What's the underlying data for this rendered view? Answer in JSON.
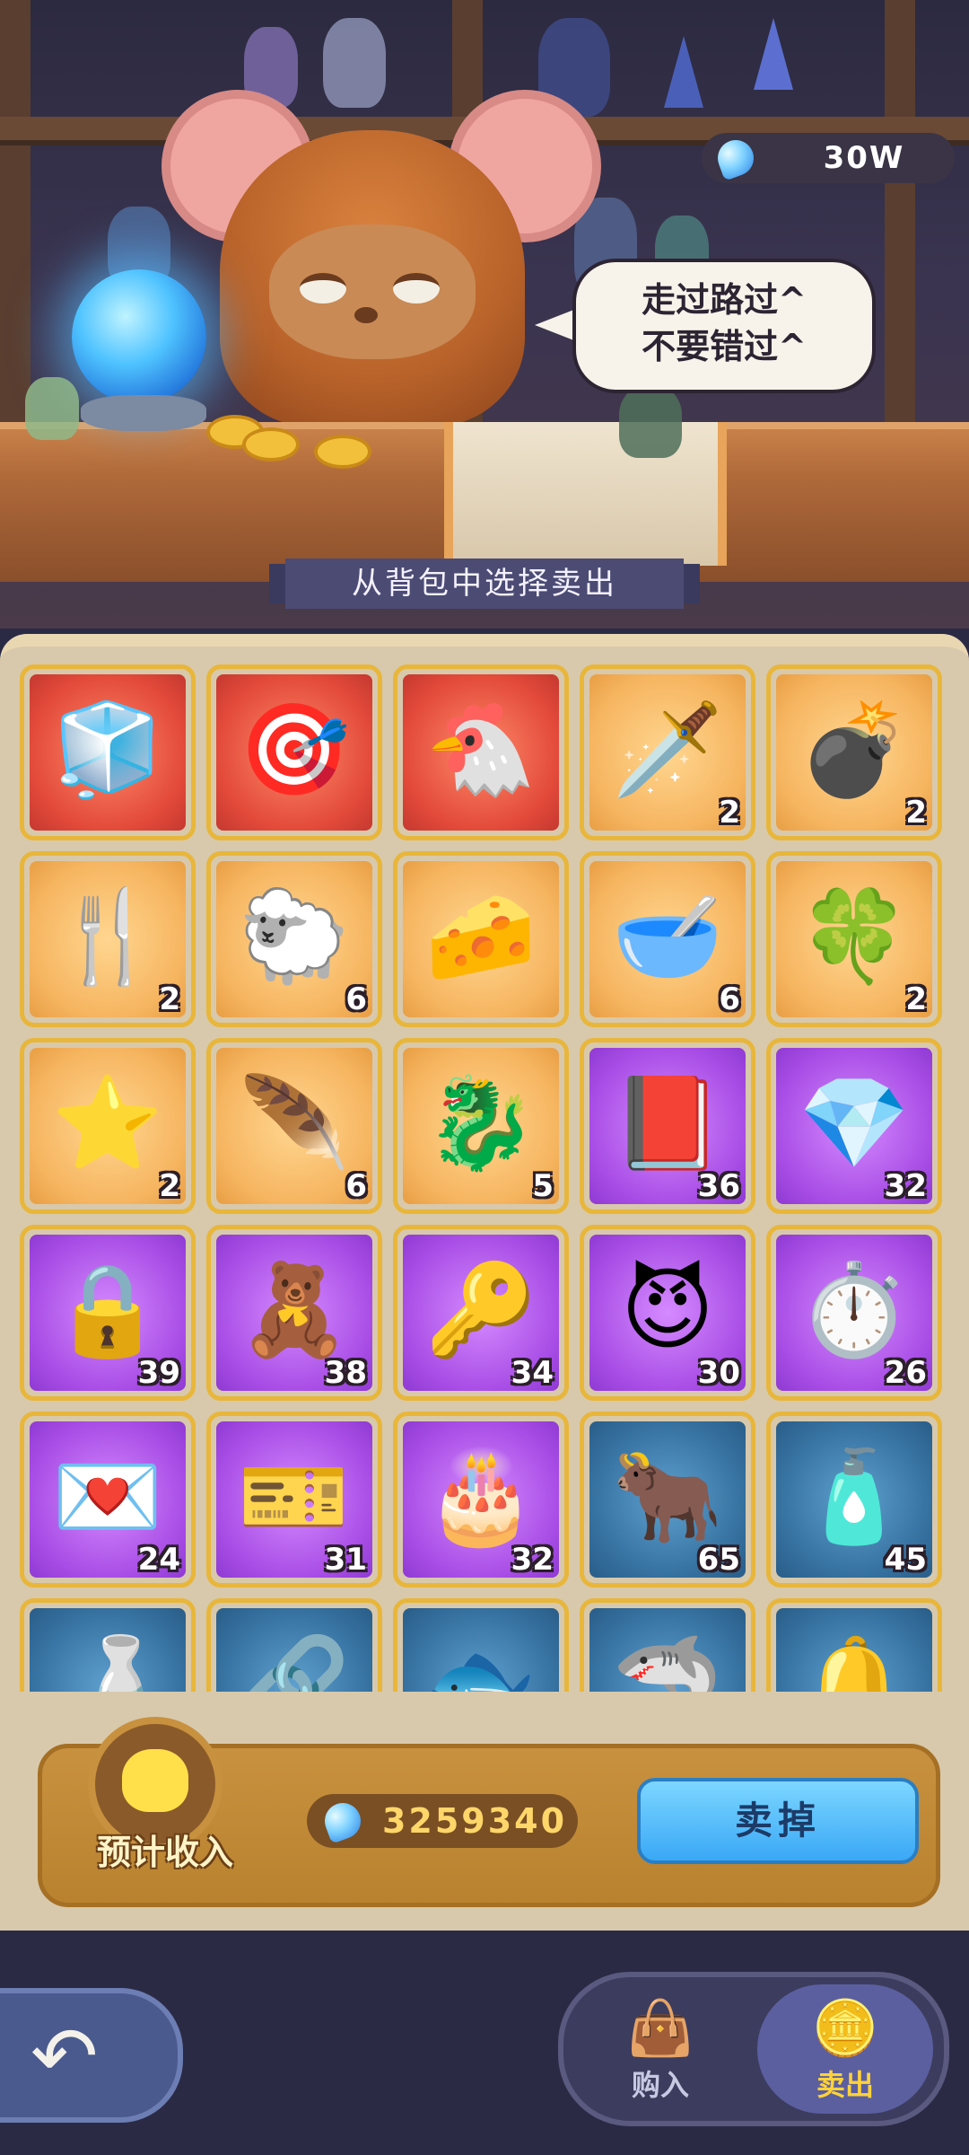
{
  "header": {
    "currency_icon": "blue-gem-icon",
    "currency_value": "30W"
  },
  "shopkeeper": {
    "speech_line_1": "走过路过^",
    "speech_line_2": "不要错过^"
  },
  "banner": {
    "text": "从背包中选择卖出"
  },
  "inventory": {
    "items": [
      {
        "name": "ice-cube",
        "icon": "🧊",
        "rarity": "red",
        "count": ""
      },
      {
        "name": "target-wheel",
        "icon": "🎯",
        "rarity": "red",
        "count": ""
      },
      {
        "name": "chicken",
        "icon": "🐔",
        "rarity": "red",
        "count": ""
      },
      {
        "name": "golden-dagger",
        "icon": "🗡️",
        "rarity": "gold",
        "count": "2"
      },
      {
        "name": "star-cannon",
        "icon": "💣",
        "rarity": "gold",
        "count": "2"
      },
      {
        "name": "golden-fork",
        "icon": "🍴",
        "rarity": "gold",
        "count": "2"
      },
      {
        "name": "golden-sheep",
        "icon": "🐑",
        "rarity": "gold",
        "count": "6"
      },
      {
        "name": "cheese",
        "icon": "🧀",
        "rarity": "gold",
        "count": ""
      },
      {
        "name": "golden-bowl",
        "icon": "🥣",
        "rarity": "gold",
        "count": "6"
      },
      {
        "name": "clover-coin",
        "icon": "🍀",
        "rarity": "gold",
        "count": "2"
      },
      {
        "name": "star-potion",
        "icon": "⭐",
        "rarity": "gold",
        "count": "2"
      },
      {
        "name": "golden-wing",
        "icon": "🪶",
        "rarity": "gold",
        "count": "6"
      },
      {
        "name": "golden-dragon",
        "icon": "🐉",
        "rarity": "gold",
        "count": "5"
      },
      {
        "name": "red-book",
        "icon": "📕",
        "rarity": "purple",
        "count": "36"
      },
      {
        "name": "blue-gem",
        "icon": "💎",
        "rarity": "purple",
        "count": "32"
      },
      {
        "name": "chain-lock",
        "icon": "🔒",
        "rarity": "purple",
        "count": "39"
      },
      {
        "name": "teddy-bear",
        "icon": "🧸",
        "rarity": "purple",
        "count": "38"
      },
      {
        "name": "silver-key",
        "icon": "🔑",
        "rarity": "purple",
        "count": "34"
      },
      {
        "name": "candy-devil",
        "icon": "😈",
        "rarity": "purple",
        "count": "30"
      },
      {
        "name": "stopwatch",
        "icon": "⏱️",
        "rarity": "purple",
        "count": "26"
      },
      {
        "name": "love-letter",
        "icon": "💌",
        "rarity": "purple",
        "count": "24"
      },
      {
        "name": "vip-ticket",
        "icon": "🎫",
        "rarity": "purple",
        "count": "31"
      },
      {
        "name": "birthday-cake",
        "icon": "🎂",
        "rarity": "purple",
        "count": "32"
      },
      {
        "name": "ox-totem",
        "icon": "🐂",
        "rarity": "blue",
        "count": "65"
      },
      {
        "name": "water-bottle",
        "icon": "🧴",
        "rarity": "blue",
        "count": "45"
      },
      {
        "name": "small-bottle",
        "icon": "🍶",
        "rarity": "blue",
        "count": ""
      },
      {
        "name": "key-ring",
        "icon": "🔗",
        "rarity": "blue",
        "count": ""
      },
      {
        "name": "blue-fish",
        "icon": "🐟",
        "rarity": "blue",
        "count": ""
      },
      {
        "name": "blue-fin",
        "icon": "🦈",
        "rarity": "blue",
        "count": ""
      },
      {
        "name": "golden-bell",
        "icon": "🔔",
        "rarity": "blue",
        "count": ""
      }
    ]
  },
  "income": {
    "icon": "gold-sack-icon",
    "label": "预计收入",
    "value": "3259340",
    "sell_button": "卖掉"
  },
  "nav": {
    "back_icon": "back-arrow-icon",
    "buy_label": "购入",
    "buy_icon": "shopping-bag-icon",
    "sell_label": "卖出",
    "sell_icon": "coin-stack-icon"
  },
  "colors": {
    "rarity_red": "#e34a3a",
    "rarity_gold": "#f6b560",
    "rarity_purple": "#a94ee6",
    "rarity_blue": "#35709f",
    "sell_button": "#3aa8f6",
    "accent_gold": "#ffd23a"
  }
}
